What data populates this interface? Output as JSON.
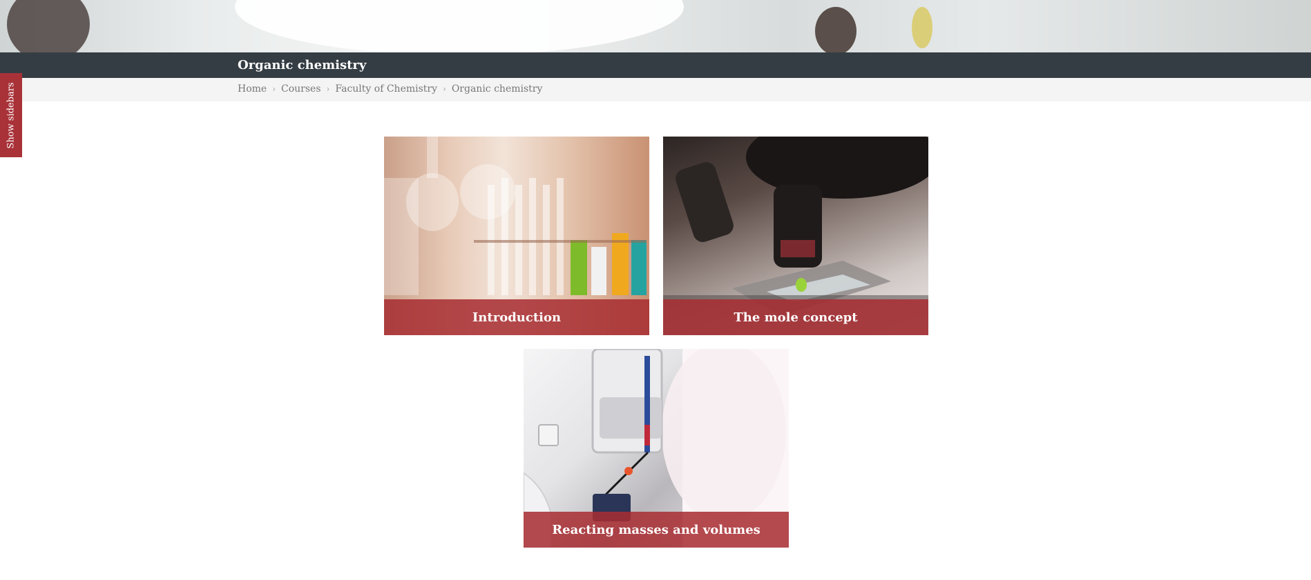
{
  "header": {
    "page_title": "Organic chemistry"
  },
  "breadcrumb": {
    "items": [
      "Home",
      "Courses",
      "Faculty of Chemistry",
      "Organic chemistry"
    ]
  },
  "sidebar_toggle": {
    "label": "Show sidebars"
  },
  "courses": [
    {
      "title": "Introduction"
    },
    {
      "title": "The mole concept"
    },
    {
      "title": "Reacting masses and volumes"
    }
  ],
  "colors": {
    "title_bar": "#343d43",
    "breadcrumb_bar": "#f4f4f4",
    "accent": "#a83238"
  }
}
